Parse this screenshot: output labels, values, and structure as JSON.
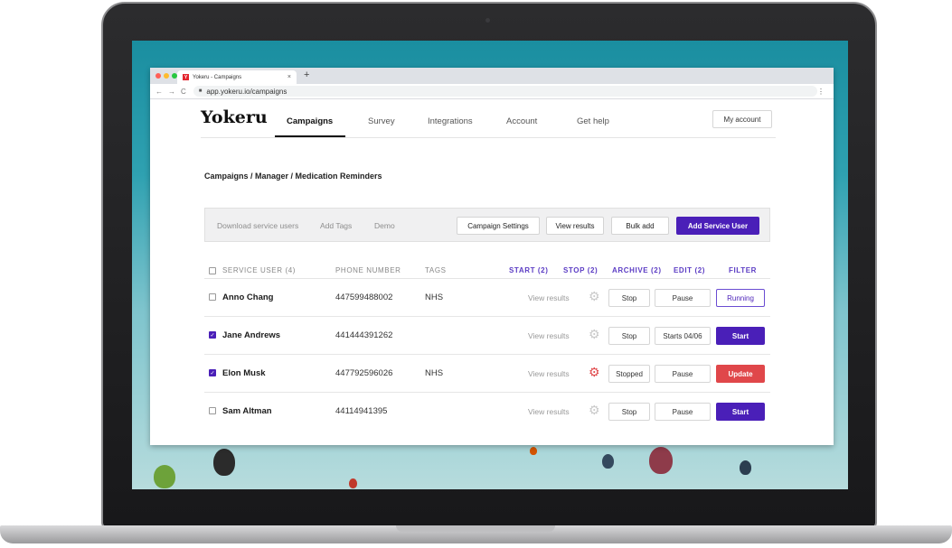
{
  "browser": {
    "tab_title": "Yokeru - Campaigns",
    "tab_favicon": "Y",
    "tab_close": "×",
    "new_tab": "+",
    "url": "app.yokeru.io/campaigns",
    "back": "←",
    "forward": "→",
    "reload": "C",
    "menu": "⋮"
  },
  "app": {
    "logo": "Yokeru",
    "nav": {
      "campaigns": "Campaigns",
      "survey": "Survey",
      "integrations": "Integrations",
      "account": "Account",
      "help": "Get help"
    },
    "my_account": "My account",
    "breadcrumb": "Campaigns / Manager / Medication Reminders",
    "toolbar": {
      "download": "Download service users",
      "add_tags": "Add Tags",
      "demo": "Demo",
      "campaign_settings": "Campaign Settings",
      "view_results": "View results",
      "bulk_add": "Bulk add",
      "add_service_user": "Add Service User"
    },
    "table": {
      "headers": {
        "service_user": "SERVICE USER (4)",
        "phone": "PHONE NUMBER",
        "tags": "TAGS",
        "start": "START (2)",
        "stop": "STOP (2)",
        "archive": "ARCHIVE (2)",
        "edit": "EDIT (2)",
        "filter": "FILTER"
      },
      "rows": [
        {
          "name": "Anno Chang",
          "phone": "447599488002",
          "tag": "NHS",
          "checked": false,
          "view": "View results",
          "stop": "Stop",
          "edit": "Pause",
          "action": "Running"
        },
        {
          "name": "Jane Andrews",
          "phone": "441444391262",
          "tag": "",
          "checked": true,
          "view": "View results",
          "stop": "Stop",
          "edit": "Starts 04/06",
          "action": "Start"
        },
        {
          "name": "Elon Musk",
          "phone": "447792596026",
          "tag": "NHS",
          "checked": true,
          "view": "View results",
          "stop": "Stopped",
          "edit": "Pause",
          "action": "Update"
        },
        {
          "name": "Sam Altman",
          "phone": "44114941395",
          "tag": "",
          "checked": false,
          "view": "View results",
          "stop": "Stop",
          "edit": "Pause",
          "action": "Start"
        }
      ]
    },
    "colors": {
      "primary": "#4a1fb8",
      "danger": "#e0474a",
      "header_accent": "#5b3cc4"
    }
  }
}
